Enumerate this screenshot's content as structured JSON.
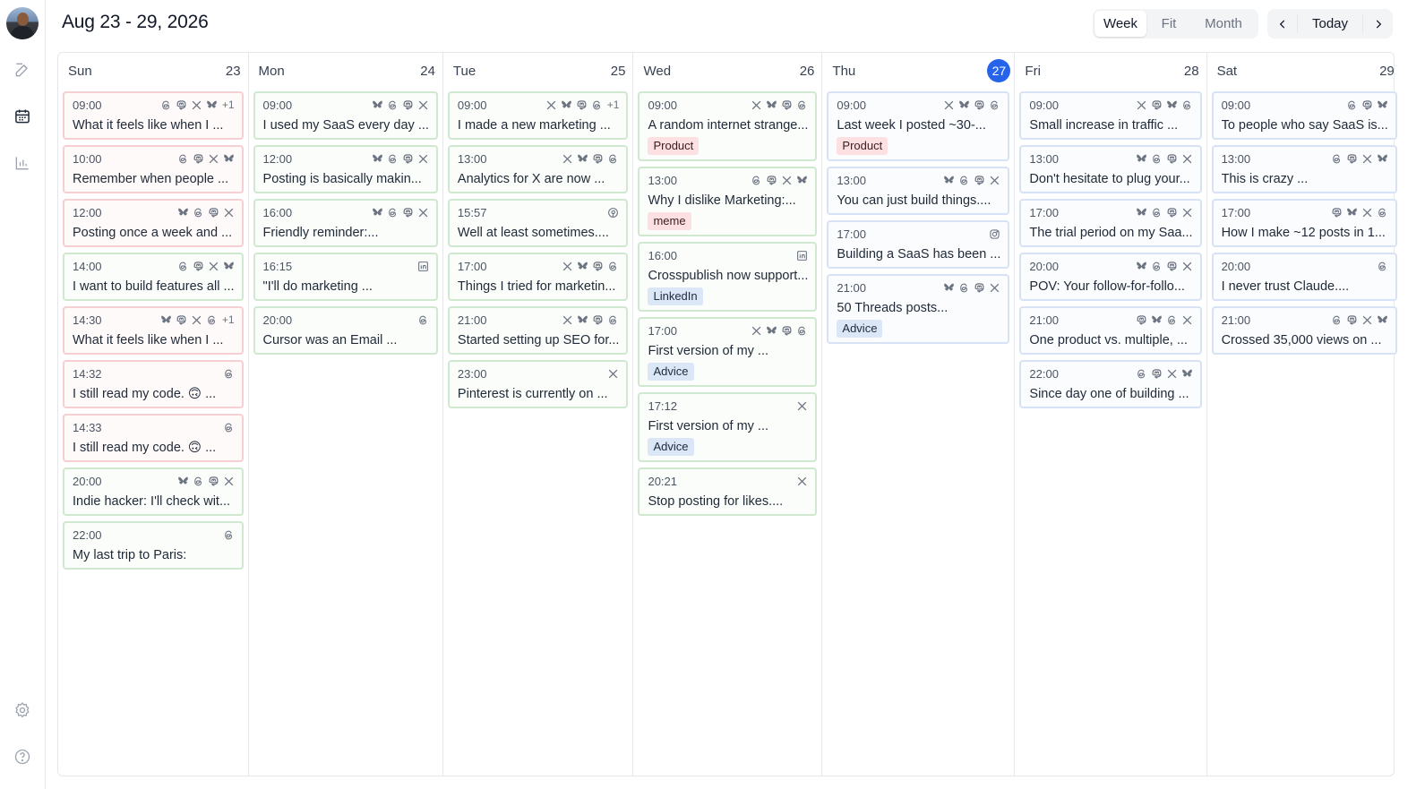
{
  "header": {
    "title": "Aug 23 - 29, 2026",
    "views": [
      "Week",
      "Fit",
      "Month"
    ],
    "active_view": "Week",
    "today_label": "Today",
    "prev_label": "‹",
    "next_label": "›"
  },
  "sidebar": {
    "items": [
      "compose-icon",
      "calendar-icon",
      "analytics-icon"
    ],
    "bottom": [
      "settings-icon",
      "help-icon"
    ]
  },
  "colors": {
    "accent": "#2563eb",
    "green_border": "#cfe8cf",
    "red_border": "#f6cfd3",
    "blue_border": "#d7e3f4"
  },
  "days": [
    {
      "name": "Sun",
      "num": "23",
      "today": false,
      "posts": [
        {
          "time": "09:00",
          "text": "What it feels like when I ...",
          "color": "red",
          "icons": [
            "threads",
            "mastodon",
            "x",
            "bluesky"
          ],
          "extra": "+1"
        },
        {
          "time": "10:00",
          "text": "Remember when people ...",
          "color": "red",
          "icons": [
            "threads",
            "mastodon",
            "x",
            "bluesky"
          ]
        },
        {
          "time": "12:00",
          "text": "Posting once a week and ...",
          "color": "red",
          "icons": [
            "bluesky",
            "threads",
            "mastodon",
            "x"
          ]
        },
        {
          "time": "14:00",
          "text": "I want to build features all ...",
          "color": "green",
          "icons": [
            "threads",
            "mastodon",
            "x",
            "bluesky"
          ]
        },
        {
          "time": "14:30",
          "text": "What it feels like when I ...",
          "color": "red",
          "icons": [
            "bluesky",
            "mastodon",
            "x",
            "threads"
          ],
          "extra": "+1"
        },
        {
          "time": "14:32",
          "text": "I still read my code. 🙃 ...",
          "color": "red",
          "icons": [
            "threads"
          ]
        },
        {
          "time": "14:33",
          "text": "I still read my code. 🙃 ...",
          "color": "red",
          "icons": [
            "threads"
          ]
        },
        {
          "time": "20:00",
          "text": "Indie hacker: I'll check wit...",
          "color": "green",
          "icons": [
            "bluesky",
            "threads",
            "mastodon",
            "x"
          ]
        },
        {
          "time": "22:00",
          "text": "My last trip to Paris:",
          "color": "green",
          "icons": [
            "threads"
          ]
        }
      ]
    },
    {
      "name": "Mon",
      "num": "24",
      "today": false,
      "posts": [
        {
          "time": "09:00",
          "text": "I used my SaaS every day ...",
          "color": "green",
          "icons": [
            "bluesky",
            "threads",
            "mastodon",
            "x"
          ]
        },
        {
          "time": "12:00",
          "text": "Posting is basically makin...",
          "color": "green",
          "icons": [
            "bluesky",
            "threads",
            "mastodon",
            "x"
          ]
        },
        {
          "time": "16:00",
          "text": "Friendly reminder:...",
          "color": "green",
          "icons": [
            "bluesky",
            "threads",
            "mastodon",
            "x"
          ]
        },
        {
          "time": "16:15",
          "text": "\"I'll do marketing ...",
          "color": "green",
          "icons": [
            "linkedin"
          ]
        },
        {
          "time": "20:00",
          "text": "Cursor was an Email ...",
          "color": "green",
          "icons": [
            "threads"
          ]
        }
      ]
    },
    {
      "name": "Tue",
      "num": "25",
      "today": false,
      "posts": [
        {
          "time": "09:00",
          "text": "I made a new marketing ...",
          "color": "green",
          "icons": [
            "x",
            "bluesky",
            "mastodon",
            "threads"
          ],
          "extra": "+1"
        },
        {
          "time": "13:00",
          "text": "Analytics for X are now ...",
          "color": "green",
          "icons": [
            "x",
            "bluesky",
            "mastodon",
            "threads"
          ]
        },
        {
          "time": "15:57",
          "text": "Well at least sometimes....",
          "color": "green",
          "icons": [
            "pinterest"
          ]
        },
        {
          "time": "17:00",
          "text": "Things I tried for marketin...",
          "color": "green",
          "icons": [
            "x",
            "bluesky",
            "mastodon",
            "threads"
          ]
        },
        {
          "time": "21:00",
          "text": "Started setting up SEO for...",
          "color": "green",
          "icons": [
            "x",
            "bluesky",
            "mastodon",
            "threads"
          ]
        },
        {
          "time": "23:00",
          "text": "Pinterest is currently on ...",
          "color": "green",
          "icons": [
            "x"
          ]
        }
      ]
    },
    {
      "name": "Wed",
      "num": "26",
      "today": false,
      "posts": [
        {
          "time": "09:00",
          "text": "A random internet strange...",
          "color": "green",
          "icons": [
            "x",
            "bluesky",
            "mastodon",
            "threads"
          ],
          "tag": "Product"
        },
        {
          "time": "13:00",
          "text": "Why I dislike Marketing:...",
          "color": "green",
          "icons": [
            "threads",
            "mastodon",
            "x",
            "bluesky"
          ],
          "tag": "meme"
        },
        {
          "time": "16:00",
          "text": "Crosspublish now support...",
          "color": "green",
          "icons": [
            "linkedin"
          ],
          "tag": "LinkedIn"
        },
        {
          "time": "17:00",
          "text": "First version of my ...",
          "color": "green",
          "icons": [
            "x",
            "bluesky",
            "mastodon",
            "threads"
          ],
          "tag": "Advice"
        },
        {
          "time": "17:12",
          "text": "First version of my ...",
          "color": "green",
          "icons": [
            "x"
          ],
          "tag": "Advice"
        },
        {
          "time": "20:21",
          "text": "Stop posting for likes....",
          "color": "green",
          "icons": [
            "x"
          ]
        }
      ]
    },
    {
      "name": "Thu",
      "num": "27",
      "today": true,
      "posts": [
        {
          "time": "09:00",
          "text": "Last week I posted ~30-...",
          "color": "blue",
          "icons": [
            "x",
            "bluesky",
            "mastodon",
            "threads"
          ],
          "tag": "Product"
        },
        {
          "time": "13:00",
          "text": "You can just build things....",
          "color": "blue",
          "icons": [
            "bluesky",
            "threads",
            "mastodon",
            "x"
          ]
        },
        {
          "time": "17:00",
          "text": "Building a SaaS has been ...",
          "color": "blue",
          "icons": [
            "instagram"
          ]
        },
        {
          "time": "21:00",
          "text": "50 Threads posts...",
          "color": "blue",
          "icons": [
            "bluesky",
            "threads",
            "mastodon",
            "x"
          ],
          "tag": "Advice"
        }
      ]
    },
    {
      "name": "Fri",
      "num": "28",
      "today": false,
      "posts": [
        {
          "time": "09:00",
          "text": "Small increase in traffic ...",
          "color": "blue",
          "icons": [
            "x",
            "mastodon",
            "bluesky",
            "threads"
          ]
        },
        {
          "time": "13:00",
          "text": "Don't hesitate to plug your...",
          "color": "blue",
          "icons": [
            "bluesky",
            "threads",
            "mastodon",
            "x"
          ]
        },
        {
          "time": "17:00",
          "text": "The trial period on my Saa...",
          "color": "blue",
          "icons": [
            "bluesky",
            "threads",
            "mastodon",
            "x"
          ]
        },
        {
          "time": "20:00",
          "text": "POV: Your follow-for-follo...",
          "color": "blue",
          "icons": [
            "bluesky",
            "threads",
            "mastodon",
            "x"
          ]
        },
        {
          "time": "21:00",
          "text": "One product vs. multiple, ...",
          "color": "blue",
          "icons": [
            "mastodon",
            "bluesky",
            "threads",
            "x"
          ]
        },
        {
          "time": "22:00",
          "text": "Since day one of building ...",
          "color": "blue",
          "icons": [
            "threads",
            "mastodon",
            "x",
            "bluesky"
          ]
        }
      ]
    },
    {
      "name": "Sat",
      "num": "29",
      "today": false,
      "posts": [
        {
          "time": "09:00",
          "text": "To people who say SaaS is...",
          "color": "blue",
          "icons": [
            "threads",
            "mastodon",
            "bluesky"
          ]
        },
        {
          "time": "13:00",
          "text": "This is crazy ...",
          "color": "blue",
          "icons": [
            "threads",
            "mastodon",
            "x",
            "bluesky"
          ]
        },
        {
          "time": "17:00",
          "text": "How I make ~12 posts in 1...",
          "color": "blue",
          "icons": [
            "mastodon",
            "bluesky",
            "x",
            "threads"
          ]
        },
        {
          "time": "20:00",
          "text": "I never trust Claude....",
          "color": "blue",
          "icons": [
            "threads"
          ]
        },
        {
          "time": "21:00",
          "text": "Crossed 35,000 views on ...",
          "color": "blue",
          "icons": [
            "threads",
            "mastodon",
            "x",
            "bluesky"
          ]
        }
      ]
    }
  ]
}
